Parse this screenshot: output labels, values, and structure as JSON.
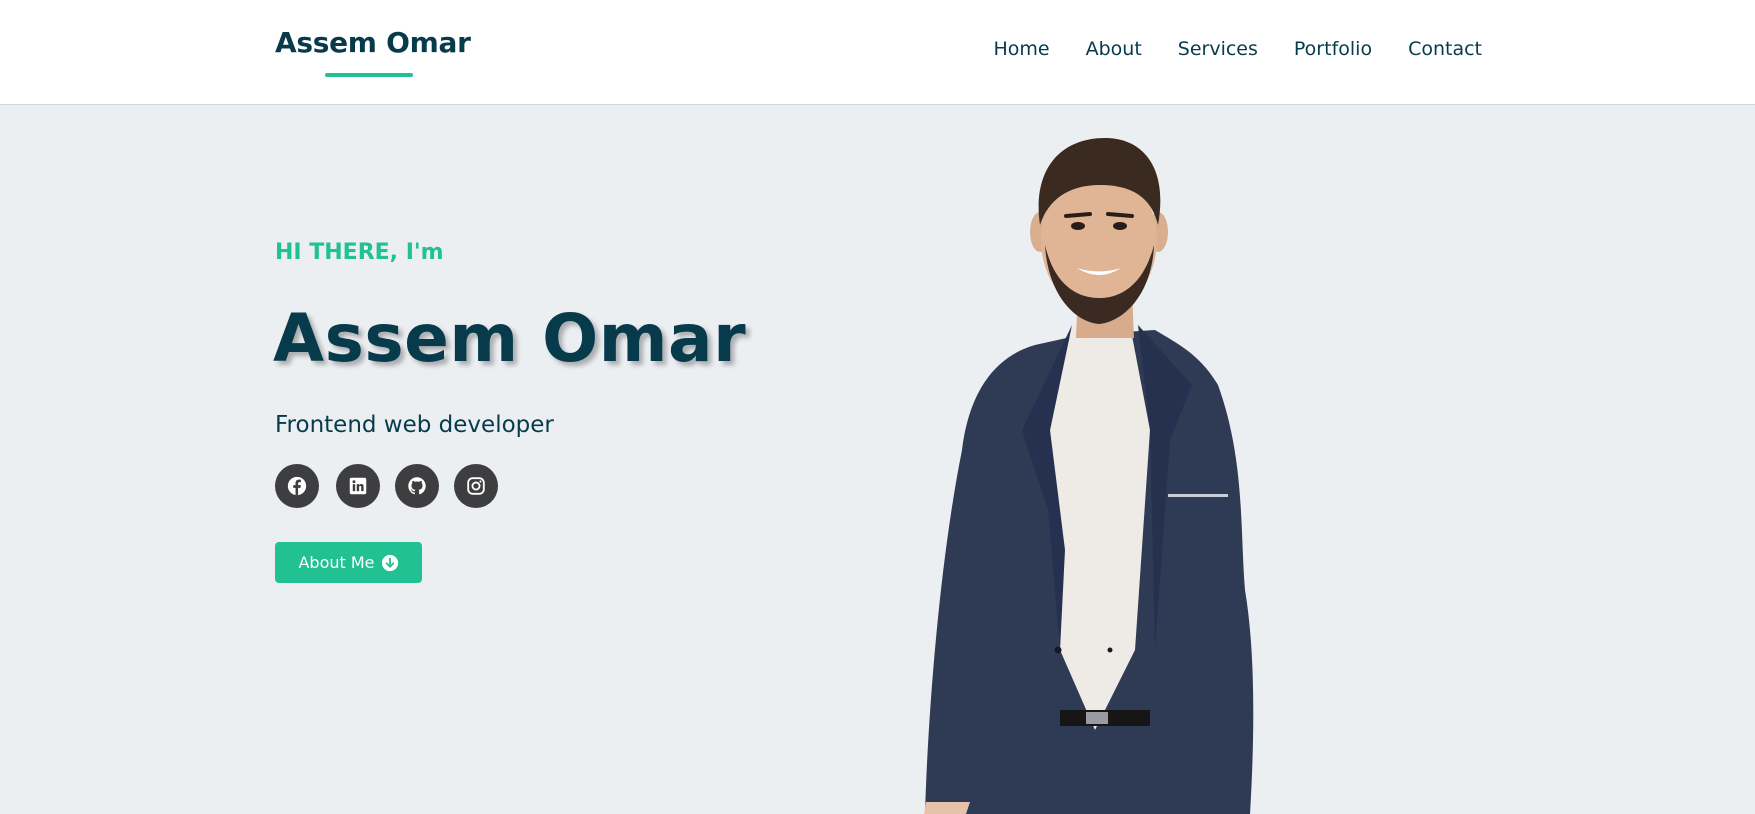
{
  "navbar": {
    "brand": "Assem Omar",
    "links": [
      "Home",
      "About",
      "Services",
      "Portfolio",
      "Contact"
    ]
  },
  "hero": {
    "greeting": "HI THERE, I'm",
    "name": "Assem Omar",
    "role": "Frontend web developer",
    "cta_label": "About Me",
    "socials": [
      "facebook-icon",
      "linkedin-icon",
      "github-icon",
      "instagram-icon"
    ]
  },
  "colors": {
    "accent": "#21c193",
    "primary_text": "#073b4c",
    "hero_background": "#eceff2",
    "navbar_background": "#ffffff",
    "social_icon_background": "#3e3e40",
    "suit": "#2f3a55"
  }
}
